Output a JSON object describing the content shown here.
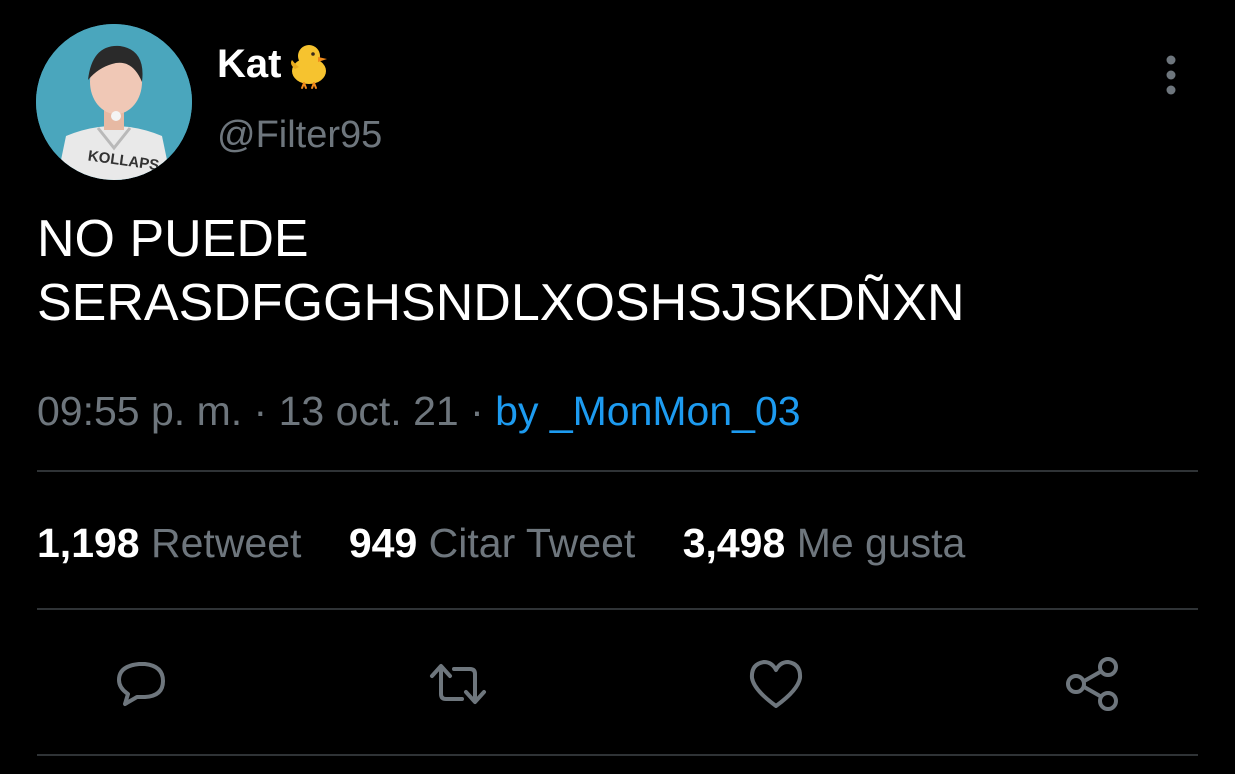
{
  "user": {
    "display_name": "Kat",
    "handle": "@Filter95",
    "avatar_shirt_text": "KOLLAPS"
  },
  "tweet": {
    "text": "NO PUEDE\nSERASDFGGHSNDLXOSHSJSKDÑXN",
    "time": "09:55 p. m.",
    "separator": "·",
    "date": "13 oct. 21",
    "source": "by _MonMon_03"
  },
  "stats": [
    {
      "count": "1,198",
      "label": "Retweet"
    },
    {
      "count": "949",
      "label": "Citar Tweet"
    },
    {
      "count": "3,498",
      "label": "Me gusta"
    }
  ],
  "actions": [
    "reply-icon",
    "retweet-icon",
    "like-icon",
    "share-icon"
  ],
  "colors": {
    "background": "#000000",
    "text": "#ffffff",
    "secondary": "#6e767d",
    "link": "#1d9bf0",
    "divider": "#2f3336"
  }
}
